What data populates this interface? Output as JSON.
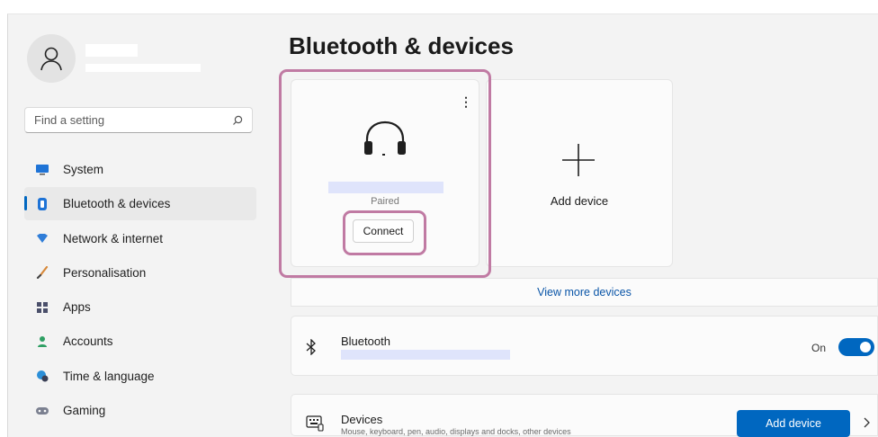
{
  "sidebar": {
    "search_placeholder": "Find a setting",
    "items": [
      {
        "label": "System",
        "icon": "monitor-icon",
        "color": "#1e73d6"
      },
      {
        "label": "Bluetooth & devices",
        "icon": "bluetooth-devices-icon",
        "color": "#1e73d6",
        "selected": true
      },
      {
        "label": "Network & internet",
        "icon": "wifi-diamond-icon",
        "color": "#2f7dd8"
      },
      {
        "label": "Personalisation",
        "icon": "brush-icon",
        "color": "#d7893a"
      },
      {
        "label": "Apps",
        "icon": "apps-icon",
        "color": "#4a4f6a"
      },
      {
        "label": "Accounts",
        "icon": "person-icon",
        "color": "#2e9f63"
      },
      {
        "label": "Time & language",
        "icon": "globe-clock-icon",
        "color": "#2b8fd8"
      },
      {
        "label": "Gaming",
        "icon": "controller-icon",
        "color": "#7b8090"
      }
    ]
  },
  "main": {
    "title": "Bluetooth & devices",
    "device_card": {
      "status": "Paired",
      "connect_label": "Connect",
      "more_icon": "more-vertical-icon"
    },
    "add_card": {
      "label": "Add device"
    },
    "view_more": "View more devices",
    "bluetooth_row": {
      "label": "Bluetooth",
      "toggle_label": "On",
      "toggle_on": true
    },
    "devices_row": {
      "label": "Devices",
      "description": "Mouse, keyboard, pen, audio, displays and docks, other devices",
      "button": "Add device"
    }
  },
  "colors": {
    "accent": "#0067c0",
    "highlight": "#c07aa3",
    "redaction": "#dfe4fb"
  }
}
